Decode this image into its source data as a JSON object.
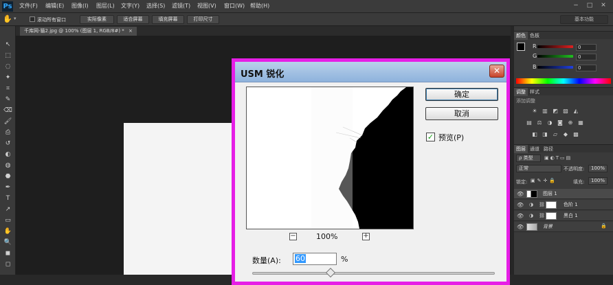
{
  "app": {
    "logo": "Ps"
  },
  "menubar": {
    "items": [
      "文件(F)",
      "编辑(E)",
      "图像(I)",
      "图层(L)",
      "文字(Y)",
      "选择(S)",
      "滤镜(T)",
      "视图(V)",
      "窗口(W)",
      "帮助(H)"
    ],
    "window_controls": [
      "−",
      "□",
      "✕"
    ]
  },
  "options_bar": {
    "tool_icon": "hand-icon",
    "checkbox_label": "滚动所有窗口",
    "buttons": [
      "实际像素",
      "适合屏幕",
      "填充屏幕",
      "打印尺寸"
    ],
    "workspace": "基本功能"
  },
  "document_tab": {
    "title": "千库网-猫2.jpg @ 100% (图层 1, RGB/8#) *",
    "close": "×"
  },
  "dialog": {
    "title": "USM 锐化",
    "close": "✕",
    "ok_label": "确定",
    "cancel_label": "取消",
    "preview_label": "预览(P)",
    "preview_checked": "✓",
    "zoom_out": "−",
    "zoom_in": "+",
    "zoom_value": "100%",
    "amount_label": "数量(A):",
    "amount_value": "60",
    "amount_unit": "%"
  },
  "color_panel": {
    "tabs": [
      "颜色",
      "色板"
    ],
    "channels": [
      {
        "label": "R",
        "value": "0",
        "color": "#e02020"
      },
      {
        "label": "G",
        "value": "0",
        "color": "#20c020"
      },
      {
        "label": "B",
        "value": "0",
        "color": "#2040e0"
      }
    ]
  },
  "adjustments_panel": {
    "tabs": [
      "调整",
      "样式"
    ],
    "hint": "添加调整",
    "row1_icons": [
      "☀",
      "▥",
      "◩",
      "▨",
      "◭"
    ],
    "row2_icons": [
      "▤",
      "⚖",
      "◑",
      "◙",
      "⊕",
      "▦"
    ],
    "row3_icons": [
      "◧",
      "◨",
      "▱",
      "◆",
      "▩"
    ]
  },
  "layers_panel": {
    "tabs": [
      "图层",
      "通道",
      "路径"
    ],
    "kind_label": "ρ 类型",
    "blend_mode": "正常",
    "opacity_label": "不透明度:",
    "opacity_value": "100%",
    "lock_label": "锁定:",
    "fill_label": "填充:",
    "fill_value": "100%",
    "layers": [
      {
        "name": "图层 1",
        "selected": true
      },
      {
        "name": "色阶 1",
        "selected": false
      },
      {
        "name": "黑白 1",
        "selected": false
      },
      {
        "name": "背景",
        "selected": false
      }
    ]
  },
  "tools": [
    "↖",
    "⬚",
    "◌",
    "✦",
    "⌗",
    "✎",
    "⌫",
    "🖌",
    "⎙",
    "↺",
    "◐",
    "◍",
    "⬣",
    "✒",
    "T",
    "↗",
    "▭",
    "✋",
    "🔍",
    "◼",
    "◻"
  ]
}
